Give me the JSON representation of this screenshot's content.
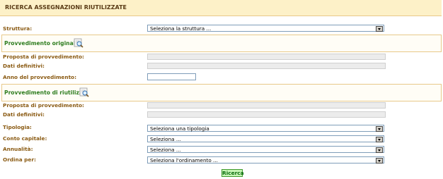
{
  "header": {
    "title": "RICERCA ASSEGNAZIONI RIUTILIZZATE"
  },
  "struttura": {
    "label": "Struttura:",
    "value": "Seleziona la struttura ..."
  },
  "original": {
    "title": "Provvedimento originale",
    "proposta_label": "Proposta di provvedimento:",
    "dati_label": "Dati definitivi:",
    "anno_label": "Anno del provvedimento:"
  },
  "reuse": {
    "title": "Provvedimento di riutilizzo",
    "proposta_label": "Proposta di provvedimento:",
    "dati_label": "Dati definitivi:"
  },
  "filters": {
    "tipologia_label": "Tipologia:",
    "tipologia_value": "Seleziona una tipologia",
    "conto_label": "Conto capitale:",
    "conto_value": "Seleziona ...",
    "annualita_label": "Annualità:",
    "annualita_value": "Seleziona ...",
    "ordina_label": "Ordina per:",
    "ordina_value": "Seleziona l'ordinamento ..."
  },
  "actions": {
    "search_label": "Ricerca"
  },
  "icons": {
    "lookup": "magnifier-icon"
  },
  "colors": {
    "label": "#8a5a12",
    "section_title": "#2e7d1f",
    "header_bg": "#fdf1c8",
    "button_bg": "#c6f5b5"
  }
}
